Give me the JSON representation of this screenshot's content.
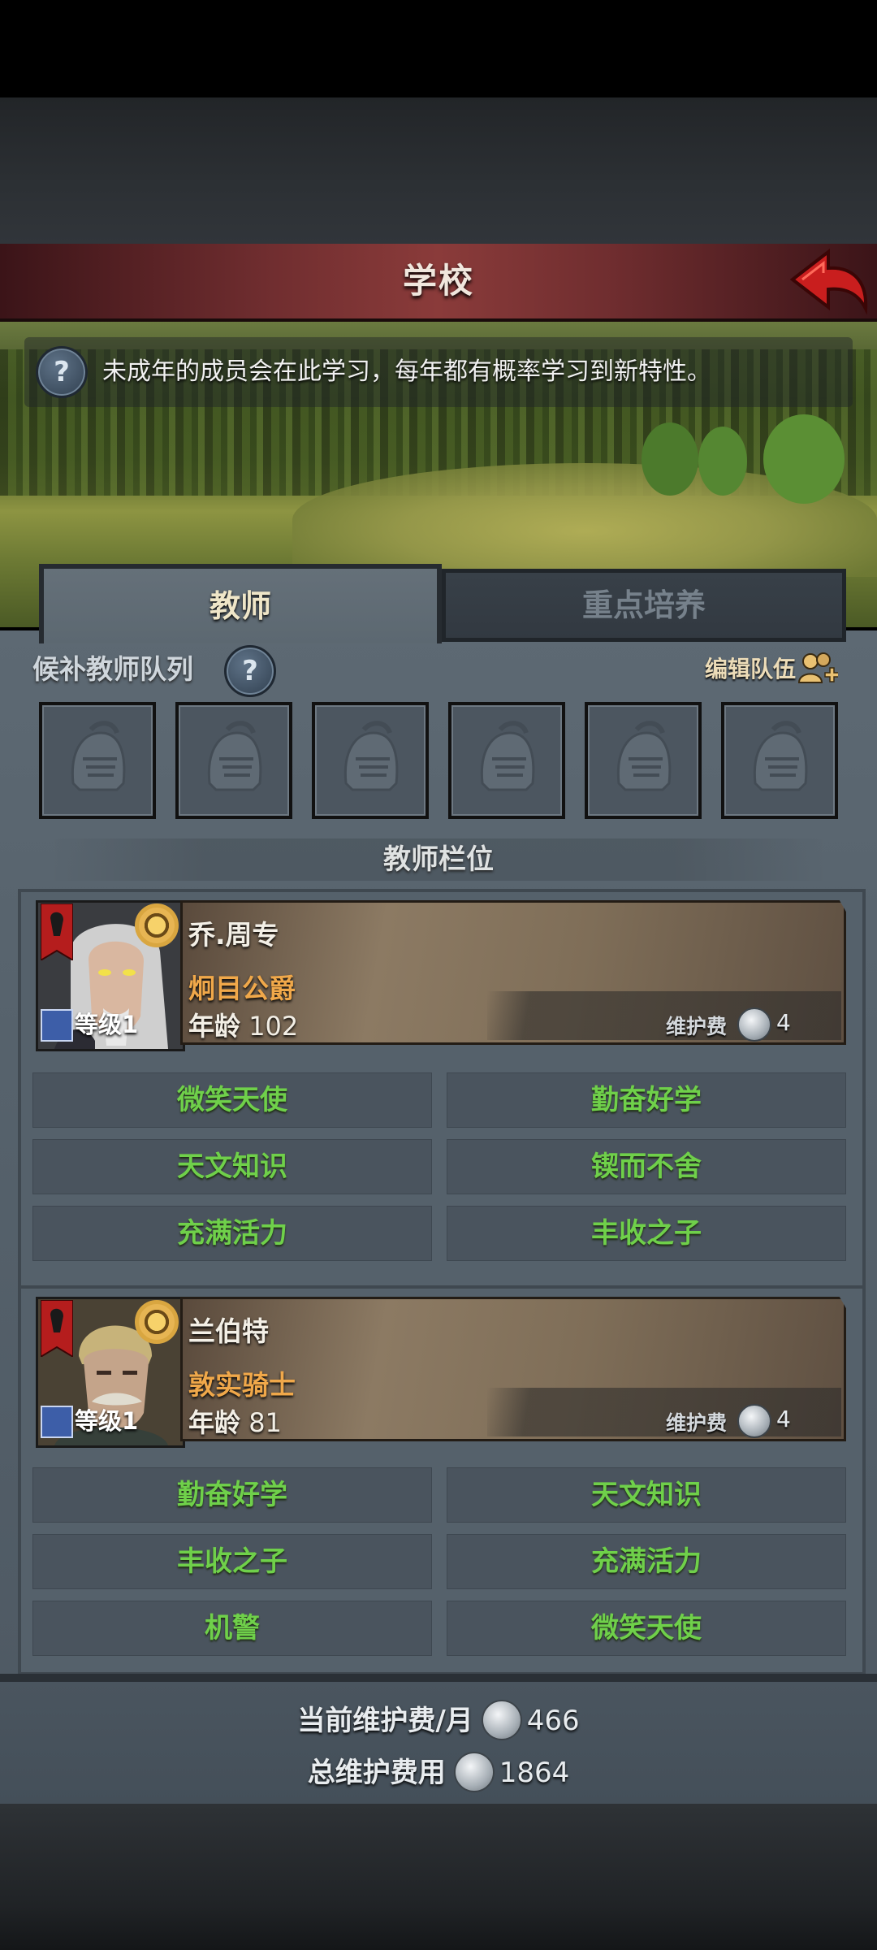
{
  "header": {
    "title": "学校"
  },
  "info": {
    "text": "未成年的成员会在此学习，每年都有概率学习到新特性。",
    "help_icon": "question-mark"
  },
  "tabs": [
    {
      "label": "教师",
      "active": true
    },
    {
      "label": "重点培养",
      "active": false
    }
  ],
  "reserve": {
    "label": "候补教师队列",
    "edit_label": "编辑队伍",
    "slot_count": 6,
    "slot_icon": "knight-helmet"
  },
  "section": {
    "title": "教师栏位"
  },
  "teachers": [
    {
      "name": "乔.周专",
      "title": "炯目公爵",
      "age_label": "年龄",
      "age": "102",
      "level_label": "等级",
      "level": "1",
      "upkeep_label": "维护费",
      "upkeep": "4",
      "traits": [
        "微笑天使",
        "勤奋好学",
        "天文知识",
        "锲而不舍",
        "充满活力",
        "丰收之子"
      ]
    },
    {
      "name": "兰伯特",
      "title": "敦实骑士",
      "age_label": "年龄",
      "age": "81",
      "level_label": "等级",
      "level": "1",
      "upkeep_label": "维护费",
      "upkeep": "4",
      "traits": [
        "勤奋好学",
        "天文知识",
        "丰收之子",
        "充满活力",
        "机警",
        "微笑天使"
      ]
    }
  ],
  "footer": {
    "monthly_label": "当前维护费/月",
    "monthly_value": "466",
    "total_label": "总维护费用",
    "total_value": "1864"
  },
  "colors": {
    "header_red": "#8a3b3a",
    "trait_green": "#6fd04a",
    "title_orange": "#f0a84a",
    "panel": "#56626c"
  }
}
